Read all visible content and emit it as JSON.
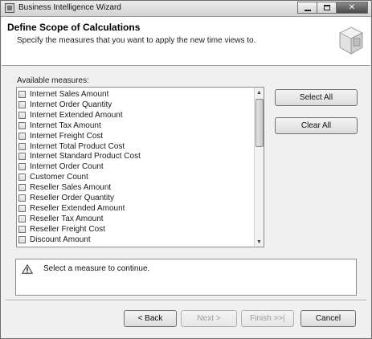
{
  "window": {
    "title": "Business Intelligence Wizard",
    "min_glyph": "minimize",
    "max_glyph": "maximize",
    "close_glyph": "x"
  },
  "header": {
    "title": "Define Scope of Calculations",
    "subtitle": "Specify the measures that you want to apply the new time views to."
  },
  "measures": {
    "label": "Available measures:",
    "items": [
      {
        "label": "Internet Sales Amount",
        "checked": false
      },
      {
        "label": "Internet Order Quantity",
        "checked": false
      },
      {
        "label": "Internet Extended Amount",
        "checked": false
      },
      {
        "label": "Internet Tax Amount",
        "checked": false
      },
      {
        "label": "Internet Freight Cost",
        "checked": false
      },
      {
        "label": "Internet Total Product Cost",
        "checked": false
      },
      {
        "label": "Internet Standard Product Cost",
        "checked": false
      },
      {
        "label": "Internet Order Count",
        "checked": false
      },
      {
        "label": "Customer Count",
        "checked": false
      },
      {
        "label": "Reseller Sales Amount",
        "checked": false
      },
      {
        "label": "Reseller Order Quantity",
        "checked": false
      },
      {
        "label": "Reseller Extended Amount",
        "checked": false
      },
      {
        "label": "Reseller Tax Amount",
        "checked": false
      },
      {
        "label": "Reseller Freight Cost",
        "checked": false
      },
      {
        "label": "Discount Amount",
        "checked": false
      }
    ]
  },
  "buttons": {
    "select_all": "Select All",
    "clear_all": "Clear All",
    "back": "< Back",
    "next": "Next >",
    "finish": "Finish >>|",
    "cancel": "Cancel"
  },
  "message": {
    "text": "Select a measure to continue.",
    "icon": "warning-icon"
  }
}
